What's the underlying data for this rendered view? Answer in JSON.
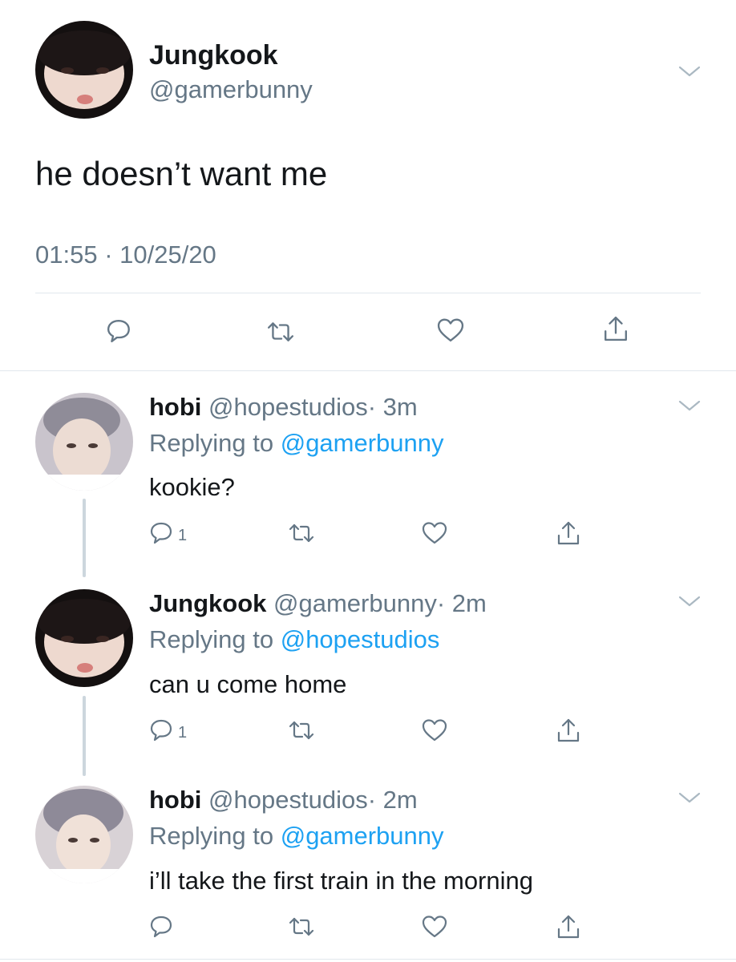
{
  "main_tweet": {
    "name": "Jungkook",
    "handle": "@gamerbunny",
    "text": "he doesn’t want me",
    "timestamp": "01:55 · 10/25/20"
  },
  "replies": [
    {
      "name": "hobi",
      "handle": "@hopestudios",
      "time": "· 3m",
      "replying_prefix": "Replying to",
      "replying_to": "@gamerbunny",
      "text": "kookie?",
      "reply_count": "1"
    },
    {
      "name": "Jungkook",
      "handle": "@gamerbunny",
      "time": "· 2m",
      "replying_prefix": "Replying to",
      "replying_to": "@hopestudios",
      "text": "can u come home",
      "reply_count": "1"
    },
    {
      "name": "hobi",
      "handle": "@hopestudios",
      "time": "· 2m",
      "replying_prefix": "Replying to",
      "replying_to": "@gamerbunny",
      "text": "i’ll take the first train in the morning",
      "reply_count": ""
    }
  ],
  "icons": {
    "reply": "speech-bubble-icon",
    "retweet": "retweet-icon",
    "like": "heart-icon",
    "share": "share-icon",
    "menu": "chevron-down-icon"
  },
  "colors": {
    "text": "#14171a",
    "muted": "#657786",
    "link": "#1da1f2",
    "divider": "#e1e8ed"
  }
}
